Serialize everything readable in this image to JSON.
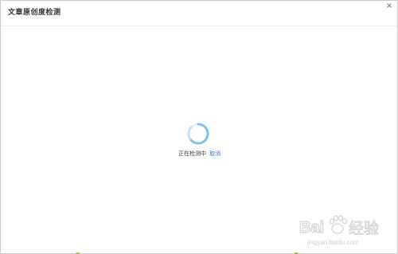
{
  "dialog": {
    "title": "文章原创度检测",
    "close_icon": "close-icon",
    "close_glyph": "×"
  },
  "loading": {
    "spinner_icon": "loading-spinner-icon",
    "spinner_color": "#7fc1ea",
    "status_text": "正在检测中",
    "cancel_label": "取消",
    "cancel_color": "#3b7be6"
  },
  "watermark": {
    "url": "jingyan.baidu.com"
  }
}
